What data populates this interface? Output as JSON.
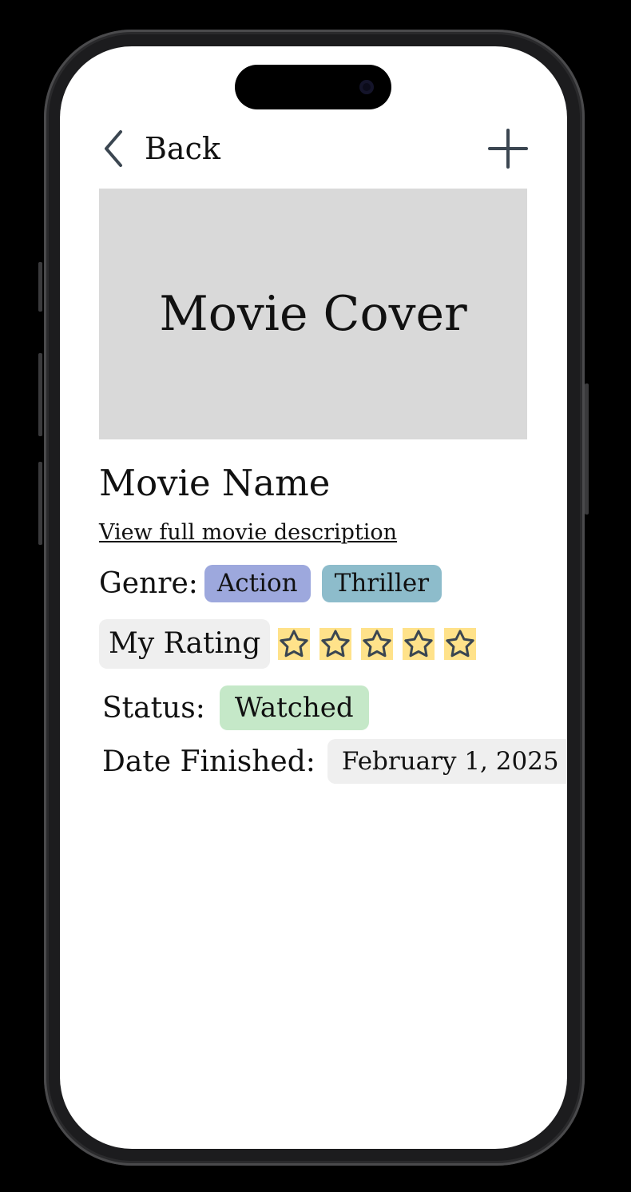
{
  "nav": {
    "back_label": "Back"
  },
  "cover": {
    "label": "Movie Cover"
  },
  "movie": {
    "name": "Movie Name",
    "description_link": "View full movie description"
  },
  "genre": {
    "label": "Genre:",
    "tags": [
      {
        "label": "Action",
        "color": "#9da8dd"
      },
      {
        "label": "Thriller",
        "color": "#8dbccb"
      }
    ]
  },
  "rating": {
    "label": "My Rating",
    "value": 0,
    "max": 5,
    "star_fill": "#ffe28a",
    "star_outline": "#3b4651"
  },
  "status": {
    "label": "Status:",
    "value": "Watched",
    "color": "#c5e8c8"
  },
  "date_finished": {
    "label": "Date Finished:",
    "value": "February 1, 2025"
  },
  "icons": {
    "back": "chevron-left-icon",
    "add": "plus-icon",
    "star": "star-outline-icon"
  }
}
